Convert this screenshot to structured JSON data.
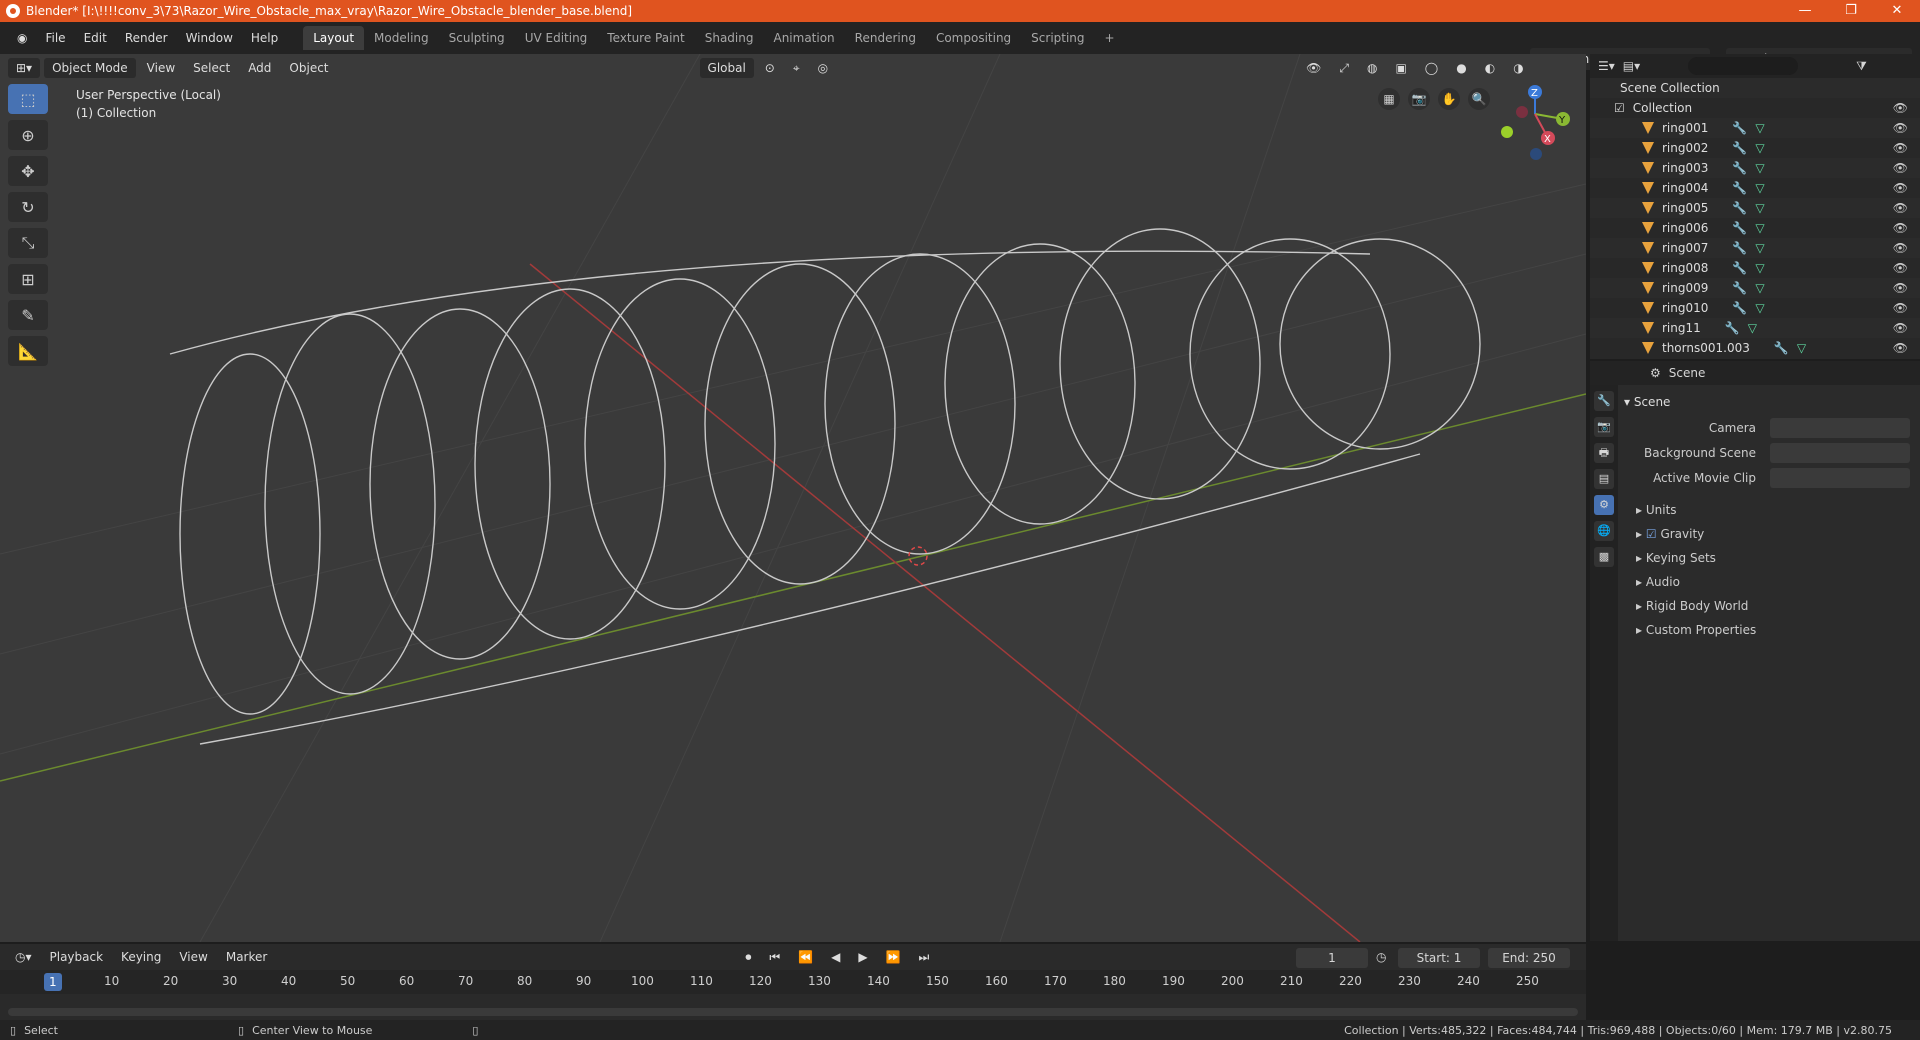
{
  "titlebar": {
    "title": "Blender* [I:\\!!!!conv_3\\73\\Razor_Wire_Obstacle_max_vray\\Razor_Wire_Obstacle_blender_base.blend]"
  },
  "menu": {
    "items": [
      "File",
      "Edit",
      "Render",
      "Window",
      "Help"
    ]
  },
  "workspaces": [
    "Layout",
    "Modeling",
    "Sculpting",
    "UV Editing",
    "Texture Paint",
    "Shading",
    "Animation",
    "Rendering",
    "Compositing",
    "Scripting",
    "+"
  ],
  "scene_selector": "Scene",
  "view_layer_selector": "View Layer",
  "viewport": {
    "mode": "Object Mode",
    "menus": [
      "View",
      "Select",
      "Add",
      "Object"
    ],
    "transform_orientation": "Global",
    "overlay_line1": "User Perspective (Local)",
    "overlay_line2": "(1) Collection"
  },
  "gizmo": {
    "z": "Z",
    "y": "Y",
    "x": "X"
  },
  "outliner": {
    "root": "Scene Collection",
    "collection": "Collection",
    "items": [
      "ring001",
      "ring002",
      "ring003",
      "ring004",
      "ring005",
      "ring006",
      "ring007",
      "ring008",
      "ring009",
      "ring010",
      "ring11",
      "thorns001.003"
    ]
  },
  "properties": {
    "header": "Scene",
    "panel": "Scene",
    "camera_label": "Camera",
    "background_scene_label": "Background Scene",
    "active_movie_clip_label": "Active Movie Clip",
    "subpanels": [
      "Units",
      "Gravity",
      "Keying Sets",
      "Audio",
      "Rigid Body World",
      "Custom Properties"
    ],
    "gravity_checked": true
  },
  "timeline": {
    "menus": [
      "Playback",
      "Keying",
      "View",
      "Marker"
    ],
    "current_frame": "1",
    "start_label": "Start:",
    "start": "1",
    "end_label": "End:",
    "end": "250",
    "ticks": [
      "1",
      "10",
      "20",
      "30",
      "40",
      "50",
      "60",
      "70",
      "80",
      "90",
      "100",
      "110",
      "120",
      "130",
      "140",
      "150",
      "160",
      "170",
      "180",
      "190",
      "200",
      "210",
      "220",
      "230",
      "240",
      "250"
    ]
  },
  "statusbar": {
    "left1": "Select",
    "left2": "Center View to Mouse",
    "right": "Collection | Verts:485,322 | Faces:484,744 | Tris:969,488 | Objects:0/60 | Mem: 179.7 MB | v2.80.75"
  }
}
